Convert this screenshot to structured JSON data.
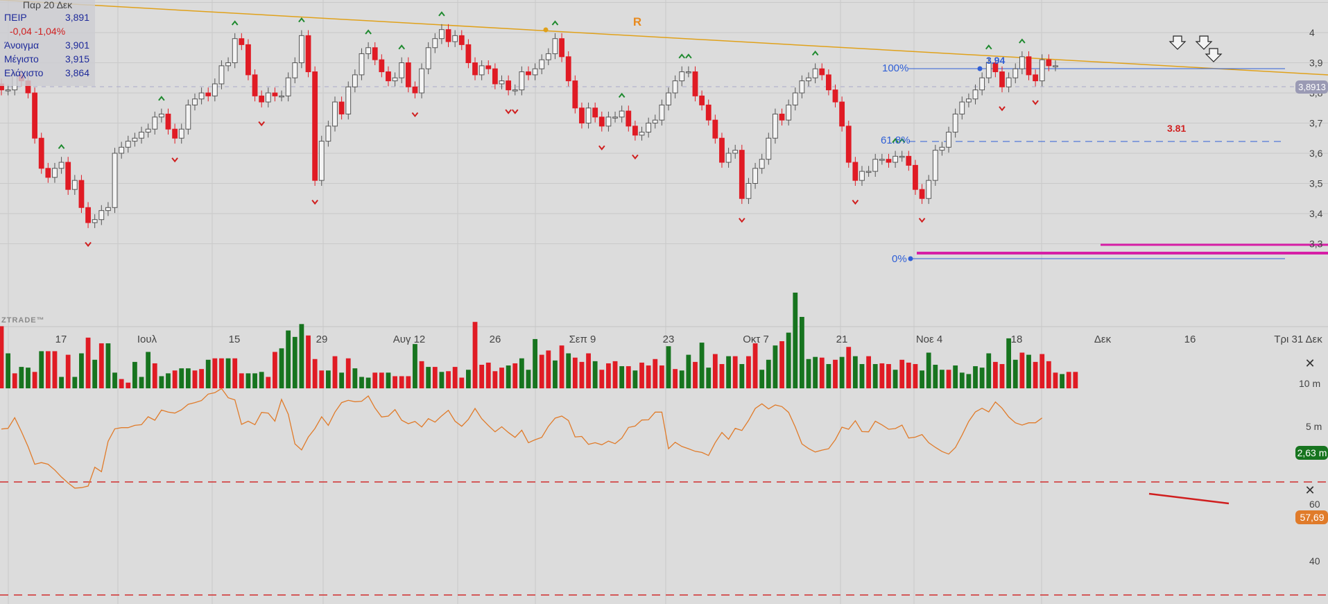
{
  "info": {
    "date": "Παρ 20 Δεκ",
    "symbol": "ΠΕΙΡ",
    "close": "3,891",
    "change": "-0,04 -1,04%",
    "open_label": "Άνοιγμα",
    "open": "3,901",
    "high_label": "Μέγιστο",
    "high": "3,915",
    "low_label": "Ελάχιστο",
    "low": "3,864"
  },
  "watermark": "ZTRADE™",
  "colors": {
    "bg": "#dcdcdc",
    "grid": "#c9c9c9",
    "up": "#17741f",
    "down": "#e01b24",
    "trend": "#e0a11a",
    "fib": "#2f5fd6",
    "support": "#d61fa6",
    "rsi": "#e07b2a",
    "rsi_band": "#d02c2c",
    "marker_up": "#1f8a2f",
    "marker_down": "#d01f1f"
  },
  "chart_data": [
    {
      "type": "candlestick",
      "ylim": [
        3.27,
        4.12
      ],
      "yticks": [
        "4",
        "3,9",
        "3,8",
        "3,7",
        "3,6",
        "3,5",
        "3,4",
        "3,3"
      ],
      "xticks": [
        "17",
        "Ιουλ",
        "15",
        "29",
        "Αυγ 12",
        "26",
        "Σεπ 9",
        "23",
        "Οκτ 7",
        "21",
        "Νοε 4",
        "18",
        "Δεκ",
        "16",
        "Τρι 31 Δεκ"
      ],
      "close": [
        3.81,
        3.81,
        3.86,
        3.84,
        3.8,
        3.65,
        3.55,
        3.52,
        3.55,
        3.57,
        3.48,
        3.51,
        3.42,
        3.37,
        3.38,
        3.41,
        3.42,
        3.6,
        3.62,
        3.64,
        3.65,
        3.67,
        3.68,
        3.72,
        3.73,
        3.68,
        3.65,
        3.68,
        3.76,
        3.78,
        3.8,
        3.79,
        3.83,
        3.89,
        3.9,
        3.98,
        3.96,
        3.86,
        3.79,
        3.77,
        3.8,
        3.79,
        3.79,
        3.85,
        3.9,
        3.99,
        3.87,
        3.51,
        3.64,
        3.69,
        3.77,
        3.73,
        3.82,
        3.86,
        3.93,
        3.95,
        3.91,
        3.87,
        3.84,
        3.85,
        3.9,
        3.82,
        3.8,
        3.88,
        3.95,
        3.98,
        4.01,
        3.97,
        3.99,
        3.96,
        3.9,
        3.86,
        3.89,
        3.88,
        3.83,
        3.84,
        3.81,
        3.81,
        3.87,
        3.86,
        3.88,
        3.91,
        3.93,
        3.98,
        3.92,
        3.84,
        3.75,
        3.7,
        3.75,
        3.72,
        3.69,
        3.72,
        3.72,
        3.74,
        3.69,
        3.66,
        3.67,
        3.7,
        3.71,
        3.76,
        3.8,
        3.84,
        3.87,
        3.87,
        3.79,
        3.76,
        3.71,
        3.65,
        3.57,
        3.6,
        3.61,
        3.45,
        3.5,
        3.55,
        3.58,
        3.65,
        3.73,
        3.71,
        3.76,
        3.8,
        3.84,
        3.85,
        3.88,
        3.86,
        3.81,
        3.77,
        3.69,
        3.57,
        3.51,
        3.54,
        3.54,
        3.58,
        3.58,
        3.57,
        3.59,
        3.59,
        3.56,
        3.48,
        3.45,
        3.51,
        3.61,
        3.62,
        3.67,
        3.73,
        3.77,
        3.78,
        3.81,
        3.85,
        3.9,
        3.87,
        3.82,
        3.85,
        3.88,
        3.92,
        3.86,
        3.84,
        3.91,
        3.89,
        3.89
      ],
      "annotations": [
        "R",
        "100%",
        "3.94",
        "61.8%",
        "0%",
        "3.81",
        "3,8913"
      ]
    },
    {
      "type": "bar",
      "series_name": "volume",
      "yticks": [
        "10 m",
        "5 m"
      ],
      "last_label": "2,63 m",
      "values_m": [
        8.7,
        4.9,
        2.1,
        3.0,
        2.9,
        2.3,
        5.2,
        5.2,
        5.2,
        1.6,
        4.7,
        1.6,
        4.9,
        7.1,
        4.0,
        6.3,
        6.3,
        2.2,
        1.3,
        0.8,
        3.7,
        1.6,
        5.1,
        3.5,
        1.7,
        2.1,
        2.5,
        2.8,
        2.8,
        2.5,
        2.7,
        4.0,
        4.2,
        4.2,
        4.2,
        4.2,
        2.1,
        2.1,
        2.1,
        2.3,
        1.6,
        5.1,
        5.6,
        8.1,
        7.2,
        9.0,
        7.4,
        4.1,
        2.5,
        2.5,
        4.5,
        2.2,
        4.2,
        2.8,
        1.6,
        1.5,
        2.2,
        2.2,
        2.2,
        1.7,
        1.7,
        1.7,
        6.2,
        3.8,
        3.0,
        3.0,
        2.3,
        2.4,
        3.0,
        1.5,
        2.6,
        9.3,
        3.3,
        3.6,
        2.4,
        2.9,
        3.2,
        3.5,
        4.2,
        2.6,
        6.9,
        4.7,
        5.3,
        3.9,
        6.0,
        4.9,
        4.3,
        3.7,
        4.9,
        3.8,
        2.6,
        3.5,
        3.8,
        3.1,
        3.1,
        2.5,
        3.6,
        3.2,
        4.1,
        3.2,
        5.9,
        2.7,
        2.5,
        4.7,
        3.7,
        6.4,
        2.9,
        4.8,
        3.4,
        4.5,
        4.5,
        3.4,
        4.5,
        6.3,
        2.6,
        4.0,
        6.0,
        6.6,
        7.8,
        13.4,
        10.0,
        4.1,
        4.4,
        4.3,
        3.4,
        4.0,
        4.4,
        5.8,
        4.5,
        3.4,
        4.5,
        3.4,
        3.5,
        3.4,
        2.6,
        4.0,
        3.6,
        3.4,
        2.5,
        5.0,
        3.3,
        2.6,
        2.6,
        3.2,
        2.2,
        2.0,
        3.1,
        2.9,
        4.9,
        3.7,
        3.4,
        7.0,
        4.0,
        5.0,
        4.7,
        3.7,
        4.8,
        3.8,
        2.2,
        2.0,
        2.3,
        2.3
      ],
      "up": [
        false,
        true,
        false,
        true,
        true,
        false,
        true,
        false,
        false,
        true,
        false,
        true,
        true,
        false,
        true,
        false,
        true,
        true,
        false,
        false,
        true,
        true,
        true,
        false,
        true,
        true,
        false,
        true,
        true,
        false,
        false,
        true,
        false,
        false,
        true,
        false,
        false,
        true,
        true,
        true,
        false,
        false,
        true,
        true,
        true,
        true,
        false,
        false,
        false,
        true,
        false,
        true,
        false,
        true,
        true,
        true,
        false,
        false,
        true,
        false,
        false,
        false,
        true,
        false,
        true,
        false,
        true,
        false,
        false,
        false,
        true,
        false,
        false,
        false,
        false,
        false,
        true,
        false,
        true,
        true,
        true,
        false,
        false,
        true,
        false,
        true,
        false,
        false,
        false,
        true,
        false,
        false,
        false,
        true,
        false,
        true,
        false,
        false,
        false,
        false,
        true,
        false,
        true,
        true,
        false,
        true,
        true,
        false,
        false,
        true,
        false,
        true,
        false,
        false,
        true,
        true,
        true,
        false,
        true,
        true,
        true,
        true,
        true,
        false,
        true,
        false,
        true,
        false,
        true,
        true,
        false,
        true,
        false,
        false,
        true,
        false,
        false,
        false,
        true,
        true,
        true,
        true,
        false,
        true,
        true,
        true,
        true,
        true,
        true,
        false,
        false,
        true,
        true,
        false,
        true,
        false,
        false,
        false,
        false,
        true,
        false
      ]
    },
    {
      "type": "line",
      "series_name": "rsi",
      "yticks": [
        "60",
        "40"
      ],
      "last_label": "57,69",
      "values": [
        52.9,
        53.2,
        57.8,
        51.8,
        45.3,
        37.7,
        38.4,
        37.7,
        35.2,
        32.2,
        29.6,
        27.4,
        27.6,
        28.3,
        36.4,
        34.5,
        47.6,
        53.0,
        53.5,
        53.5,
        54.5,
        54.8,
        58.2,
        56.7,
        61.1,
        60.2,
        59.8,
        61.2,
        63.6,
        64.3,
        65.2,
        68.0,
        68.6,
        70.4,
        66.4,
        65.5,
        54.9,
        56.3,
        54.8,
        60.1,
        59.8,
        56.3,
        65.7,
        59.3,
        46.5,
        43.9,
        49.4,
        53.1,
        58.2,
        54.5,
        60.2,
        64.3,
        65.3,
        64.7,
        64.9,
        67.2,
        62.0,
        58.1,
        58.5,
        61.3,
        56.7,
        55.2,
        56.2,
        53.8,
        57.4,
        55.9,
        58.6,
        61.0,
        56.3,
        54.1,
        57.1,
        61.8,
        57.4,
        54.4,
        51.7,
        53.9,
        51.4,
        49.3,
        52.4,
        47.0,
        48.3,
        49.3,
        54.1,
        57.6,
        58.5,
        56.6,
        49.5,
        49.7,
        46.3,
        47.0,
        46.1,
        47.7,
        46.6,
        49.0,
        53.6,
        54.2,
        56.8,
        56.9,
        60.2,
        60.2,
        44.4,
        47.2,
        45.4,
        44.4,
        43.3,
        42.8,
        41.5,
        47.0,
        51.4,
        48.5,
        53.2,
        52.3,
        56.6,
        61.8,
        63.8,
        61.6,
        63.3,
        62.6,
        60.1,
        53.8,
        46.5,
        44.5,
        43.0,
        43.8,
        44.4,
        48.3,
        53.7,
        52.8,
        56.5,
        51.8,
        51.7,
        56.3,
        54.7,
        52.8,
        53.1,
        54.6,
        49.0,
        49.4,
        50.5,
        47.0,
        45.0,
        43.2,
        42.1,
        44.9,
        50.3,
        56.2,
        60.3,
        61.9,
        60.3,
        64.6,
        61.9,
        58.1,
        55.6,
        54.6,
        55.6,
        55.6,
        57.7
      ]
    }
  ]
}
